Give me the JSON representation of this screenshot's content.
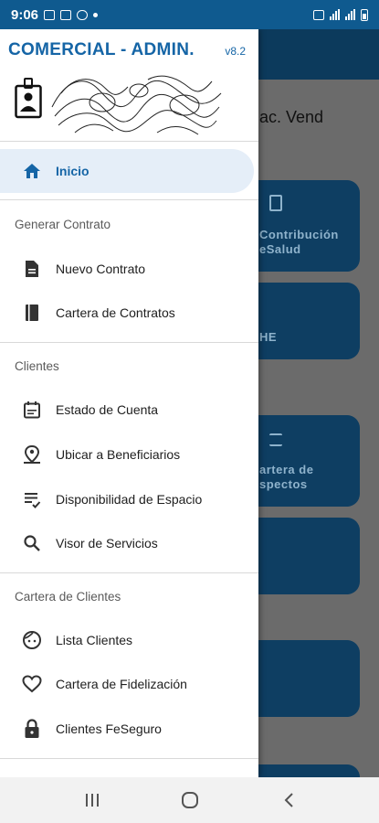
{
  "status_bar": {
    "time": "9:06"
  },
  "app": {
    "title": "COMERCIAL - ADMIN.",
    "version": "v8.2"
  },
  "background": {
    "title": "ac. Vend",
    "tiles": [
      {
        "line1": "Contribución",
        "line2": "eSalud"
      },
      {
        "line1": "HE"
      },
      {
        "line1": "artera de",
        "line2": "spectos"
      }
    ]
  },
  "menu": {
    "home": {
      "label": "Inicio",
      "icon": "home-icon"
    },
    "sections": [
      {
        "title": "Generar Contrato",
        "items": [
          {
            "label": "Nuevo Contrato",
            "icon": "document-icon"
          },
          {
            "label": "Cartera de Contratos",
            "icon": "book-icon"
          }
        ]
      },
      {
        "title": "Clientes",
        "items": [
          {
            "label": "Estado de Cuenta",
            "icon": "calendar-icon"
          },
          {
            "label": "Ubicar a Beneficiarios",
            "icon": "person-pin-icon"
          },
          {
            "label": "Disponibilidad de Espacio",
            "icon": "checklist-icon"
          },
          {
            "label": "Visor de Servicios",
            "icon": "search-icon"
          }
        ]
      },
      {
        "title": "Cartera de Clientes",
        "items": [
          {
            "label": "Lista Clientes",
            "icon": "face-icon"
          },
          {
            "label": "Cartera de Fidelización",
            "icon": "heart-icon"
          },
          {
            "label": "Clientes FeSeguro",
            "icon": "lock-icon"
          }
        ]
      }
    ]
  },
  "colors": {
    "accent": "#1565a6",
    "status_bar": "#0f5a8f",
    "active_bg": "#e5eef8"
  }
}
